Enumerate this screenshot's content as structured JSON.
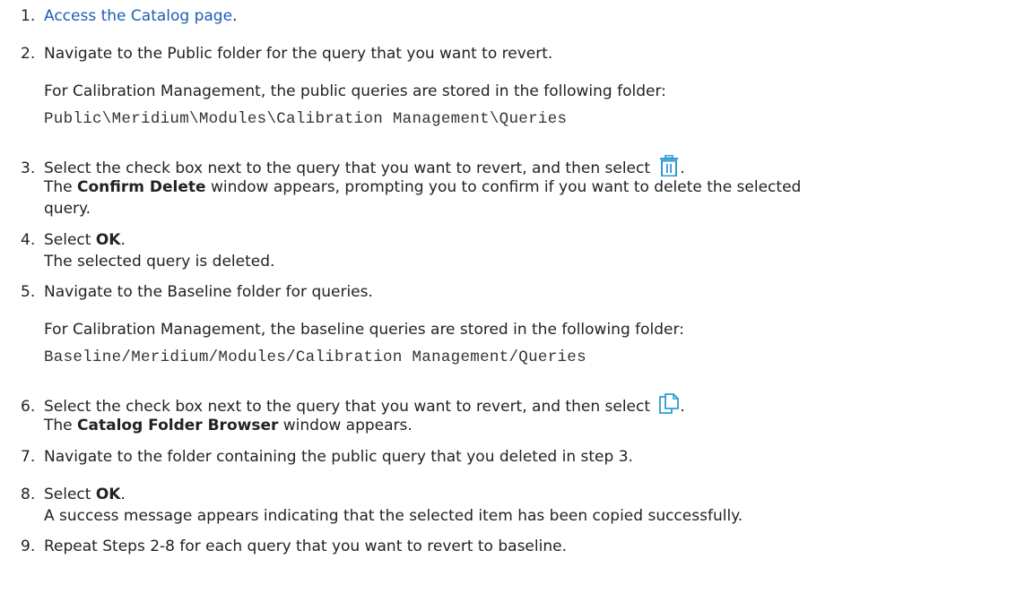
{
  "colors": {
    "link": "#1a5fb4",
    "icon": "#2e9bd6",
    "text": "#222222"
  },
  "steps": [
    {
      "num": "1.",
      "link": "Access the Catalog page",
      "after": "."
    },
    {
      "num": "2.",
      "text": "Navigate to the Public folder for the query that you want to revert.",
      "note": "For Calibration Management, the public queries are stored in the following folder:",
      "path": "Public\\Meridium\\Modules\\Calibration Management\\Queries"
    },
    {
      "num": "3.",
      "text": "Select the check box next to the query that you want to revert, and then select",
      "icon": "trash-icon",
      "after": ".",
      "result_pre": "The ",
      "result_bold": "Confirm Delete",
      "result_post_1": " window appears, prompting you to confirm if you want to delete the selected",
      "result_post_2": "query."
    },
    {
      "num": "4.",
      "pre": "Select ",
      "bold": "OK",
      "after": ".",
      "result": "The selected query is deleted."
    },
    {
      "num": "5.",
      "text": "Navigate to the Baseline folder for queries.",
      "note": "For Calibration Management, the baseline queries are stored in the following folder:",
      "path": "Baseline/Meridium/Modules/Calibration Management/Queries"
    },
    {
      "num": "6.",
      "text": "Select the check box next to the query that you want to revert, and then select",
      "icon": "copy-icon",
      "after": ".",
      "result_pre": "The ",
      "result_bold": "Catalog Folder Browser",
      "result_post": " window appears."
    },
    {
      "num": "7.",
      "text": "Navigate to the folder containing the public query that you deleted in step 3."
    },
    {
      "num": "8.",
      "pre": "Select ",
      "bold": "OK",
      "after": ".",
      "result": "A success message appears indicating that the selected item has been copied successfully."
    },
    {
      "num": "9.",
      "text": "Repeat Steps 2-8 for each query that you want to revert to baseline."
    }
  ]
}
